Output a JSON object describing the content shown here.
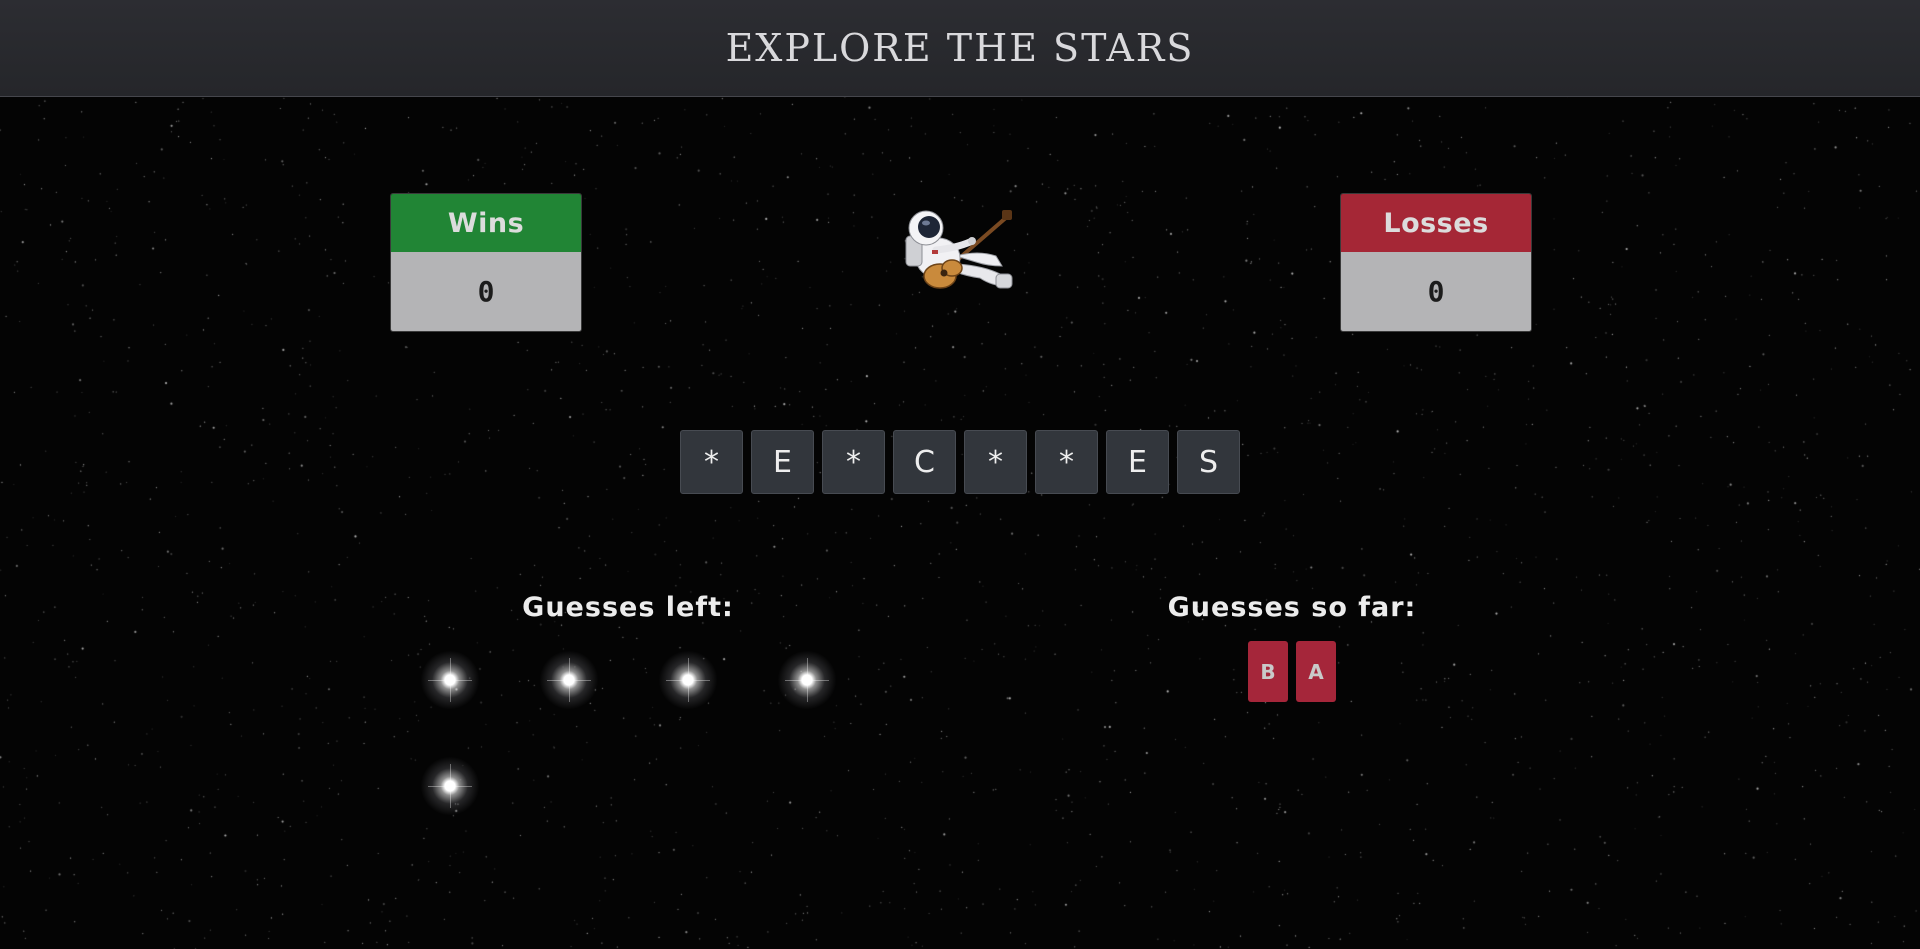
{
  "header": {
    "title": "EXPLORE THE STARS"
  },
  "scoreboard": {
    "wins": {
      "label": "Wins",
      "value": "0"
    },
    "losses": {
      "label": "Losses",
      "value": "0"
    }
  },
  "word": {
    "tiles": [
      "*",
      "E",
      "*",
      "C",
      "*",
      "*",
      "E",
      "S"
    ]
  },
  "guesses_left": {
    "heading": "Guesses left:",
    "count": 5,
    "icon": "glowing-star-icon"
  },
  "guesses_so_far": {
    "heading": "Guesses so far:",
    "letters": [
      "B",
      "A"
    ]
  },
  "colors": {
    "wins_green": "#218535",
    "losses_red": "#a52736",
    "tile_dark": "#32363c",
    "guessed_red": "#a5263a",
    "header_bg": "#2c2d32"
  }
}
